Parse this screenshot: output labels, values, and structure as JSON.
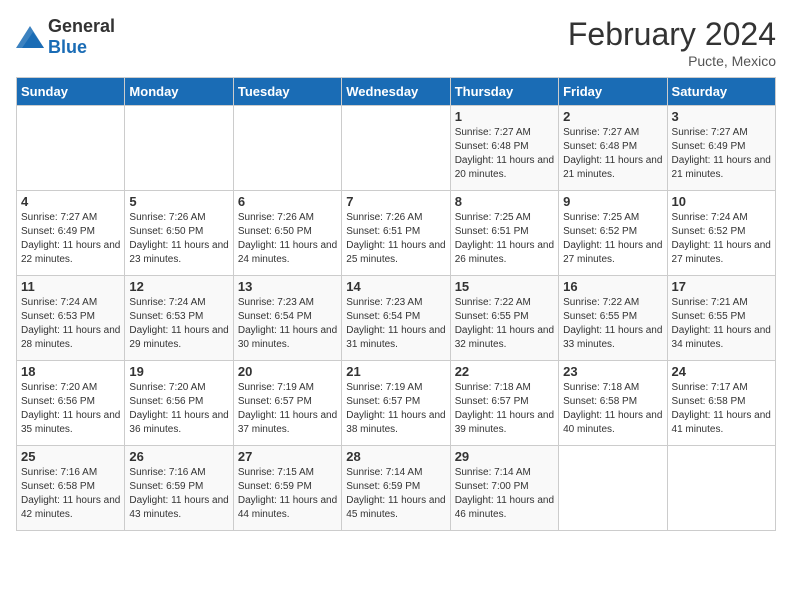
{
  "header": {
    "logo_general": "General",
    "logo_blue": "Blue",
    "title": "February 2024",
    "location": "Pucte, Mexico"
  },
  "days_of_week": [
    "Sunday",
    "Monday",
    "Tuesday",
    "Wednesday",
    "Thursday",
    "Friday",
    "Saturday"
  ],
  "weeks": [
    [
      {
        "day": "",
        "info": ""
      },
      {
        "day": "",
        "info": ""
      },
      {
        "day": "",
        "info": ""
      },
      {
        "day": "",
        "info": ""
      },
      {
        "day": "1",
        "info": "Sunrise: 7:27 AM\nSunset: 6:48 PM\nDaylight: 11 hours and 20 minutes."
      },
      {
        "day": "2",
        "info": "Sunrise: 7:27 AM\nSunset: 6:48 PM\nDaylight: 11 hours and 21 minutes."
      },
      {
        "day": "3",
        "info": "Sunrise: 7:27 AM\nSunset: 6:49 PM\nDaylight: 11 hours and 21 minutes."
      }
    ],
    [
      {
        "day": "4",
        "info": "Sunrise: 7:27 AM\nSunset: 6:49 PM\nDaylight: 11 hours and 22 minutes."
      },
      {
        "day": "5",
        "info": "Sunrise: 7:26 AM\nSunset: 6:50 PM\nDaylight: 11 hours and 23 minutes."
      },
      {
        "day": "6",
        "info": "Sunrise: 7:26 AM\nSunset: 6:50 PM\nDaylight: 11 hours and 24 minutes."
      },
      {
        "day": "7",
        "info": "Sunrise: 7:26 AM\nSunset: 6:51 PM\nDaylight: 11 hours and 25 minutes."
      },
      {
        "day": "8",
        "info": "Sunrise: 7:25 AM\nSunset: 6:51 PM\nDaylight: 11 hours and 26 minutes."
      },
      {
        "day": "9",
        "info": "Sunrise: 7:25 AM\nSunset: 6:52 PM\nDaylight: 11 hours and 27 minutes."
      },
      {
        "day": "10",
        "info": "Sunrise: 7:24 AM\nSunset: 6:52 PM\nDaylight: 11 hours and 27 minutes."
      }
    ],
    [
      {
        "day": "11",
        "info": "Sunrise: 7:24 AM\nSunset: 6:53 PM\nDaylight: 11 hours and 28 minutes."
      },
      {
        "day": "12",
        "info": "Sunrise: 7:24 AM\nSunset: 6:53 PM\nDaylight: 11 hours and 29 minutes."
      },
      {
        "day": "13",
        "info": "Sunrise: 7:23 AM\nSunset: 6:54 PM\nDaylight: 11 hours and 30 minutes."
      },
      {
        "day": "14",
        "info": "Sunrise: 7:23 AM\nSunset: 6:54 PM\nDaylight: 11 hours and 31 minutes."
      },
      {
        "day": "15",
        "info": "Sunrise: 7:22 AM\nSunset: 6:55 PM\nDaylight: 11 hours and 32 minutes."
      },
      {
        "day": "16",
        "info": "Sunrise: 7:22 AM\nSunset: 6:55 PM\nDaylight: 11 hours and 33 minutes."
      },
      {
        "day": "17",
        "info": "Sunrise: 7:21 AM\nSunset: 6:55 PM\nDaylight: 11 hours and 34 minutes."
      }
    ],
    [
      {
        "day": "18",
        "info": "Sunrise: 7:20 AM\nSunset: 6:56 PM\nDaylight: 11 hours and 35 minutes."
      },
      {
        "day": "19",
        "info": "Sunrise: 7:20 AM\nSunset: 6:56 PM\nDaylight: 11 hours and 36 minutes."
      },
      {
        "day": "20",
        "info": "Sunrise: 7:19 AM\nSunset: 6:57 PM\nDaylight: 11 hours and 37 minutes."
      },
      {
        "day": "21",
        "info": "Sunrise: 7:19 AM\nSunset: 6:57 PM\nDaylight: 11 hours and 38 minutes."
      },
      {
        "day": "22",
        "info": "Sunrise: 7:18 AM\nSunset: 6:57 PM\nDaylight: 11 hours and 39 minutes."
      },
      {
        "day": "23",
        "info": "Sunrise: 7:18 AM\nSunset: 6:58 PM\nDaylight: 11 hours and 40 minutes."
      },
      {
        "day": "24",
        "info": "Sunrise: 7:17 AM\nSunset: 6:58 PM\nDaylight: 11 hours and 41 minutes."
      }
    ],
    [
      {
        "day": "25",
        "info": "Sunrise: 7:16 AM\nSunset: 6:58 PM\nDaylight: 11 hours and 42 minutes."
      },
      {
        "day": "26",
        "info": "Sunrise: 7:16 AM\nSunset: 6:59 PM\nDaylight: 11 hours and 43 minutes."
      },
      {
        "day": "27",
        "info": "Sunrise: 7:15 AM\nSunset: 6:59 PM\nDaylight: 11 hours and 44 minutes."
      },
      {
        "day": "28",
        "info": "Sunrise: 7:14 AM\nSunset: 6:59 PM\nDaylight: 11 hours and 45 minutes."
      },
      {
        "day": "29",
        "info": "Sunrise: 7:14 AM\nSunset: 7:00 PM\nDaylight: 11 hours and 46 minutes."
      },
      {
        "day": "",
        "info": ""
      },
      {
        "day": "",
        "info": ""
      }
    ]
  ]
}
